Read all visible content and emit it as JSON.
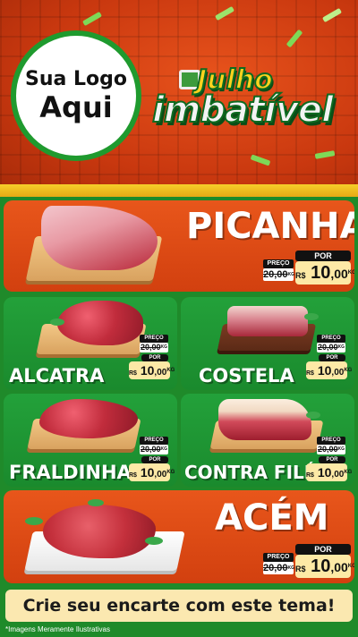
{
  "header": {
    "logo_line1": "Sua Logo",
    "logo_line2": "Aqui",
    "brand_line1": "Julho",
    "brand_line2": "imbatível"
  },
  "price_labels": {
    "old_label": "PREÇO",
    "new_label": "POR",
    "currency": "R$",
    "unit": "KG"
  },
  "products": [
    {
      "name": "PICANHA",
      "old_price": "20,00",
      "new_price_int": "10",
      "new_price_dec": ",00"
    },
    {
      "name": "ALCATRA",
      "old_price": "20,00",
      "new_price_int": "10",
      "new_price_dec": ",00"
    },
    {
      "name": "COSTELA",
      "old_price": "20,00",
      "new_price_int": "10",
      "new_price_dec": ",00"
    },
    {
      "name": "FRALDINHA",
      "old_price": "20,00",
      "new_price_int": "10",
      "new_price_dec": ",00"
    },
    {
      "name": "CONTRA FILÉ",
      "old_price": "20,00",
      "new_price_int": "10",
      "new_price_dec": ",00"
    },
    {
      "name": "ACÉM",
      "old_price": "20,00",
      "new_price_int": "10",
      "new_price_dec": ",00"
    }
  ],
  "banner": "Crie seu encarte com este tema!",
  "footnote": "*Imagens Meramente Ilustrativas",
  "colors": {
    "orange": "#e8561b",
    "green": "#1f8a2a",
    "yellow": "#f6cf2a",
    "cream": "#fbe8b0"
  }
}
